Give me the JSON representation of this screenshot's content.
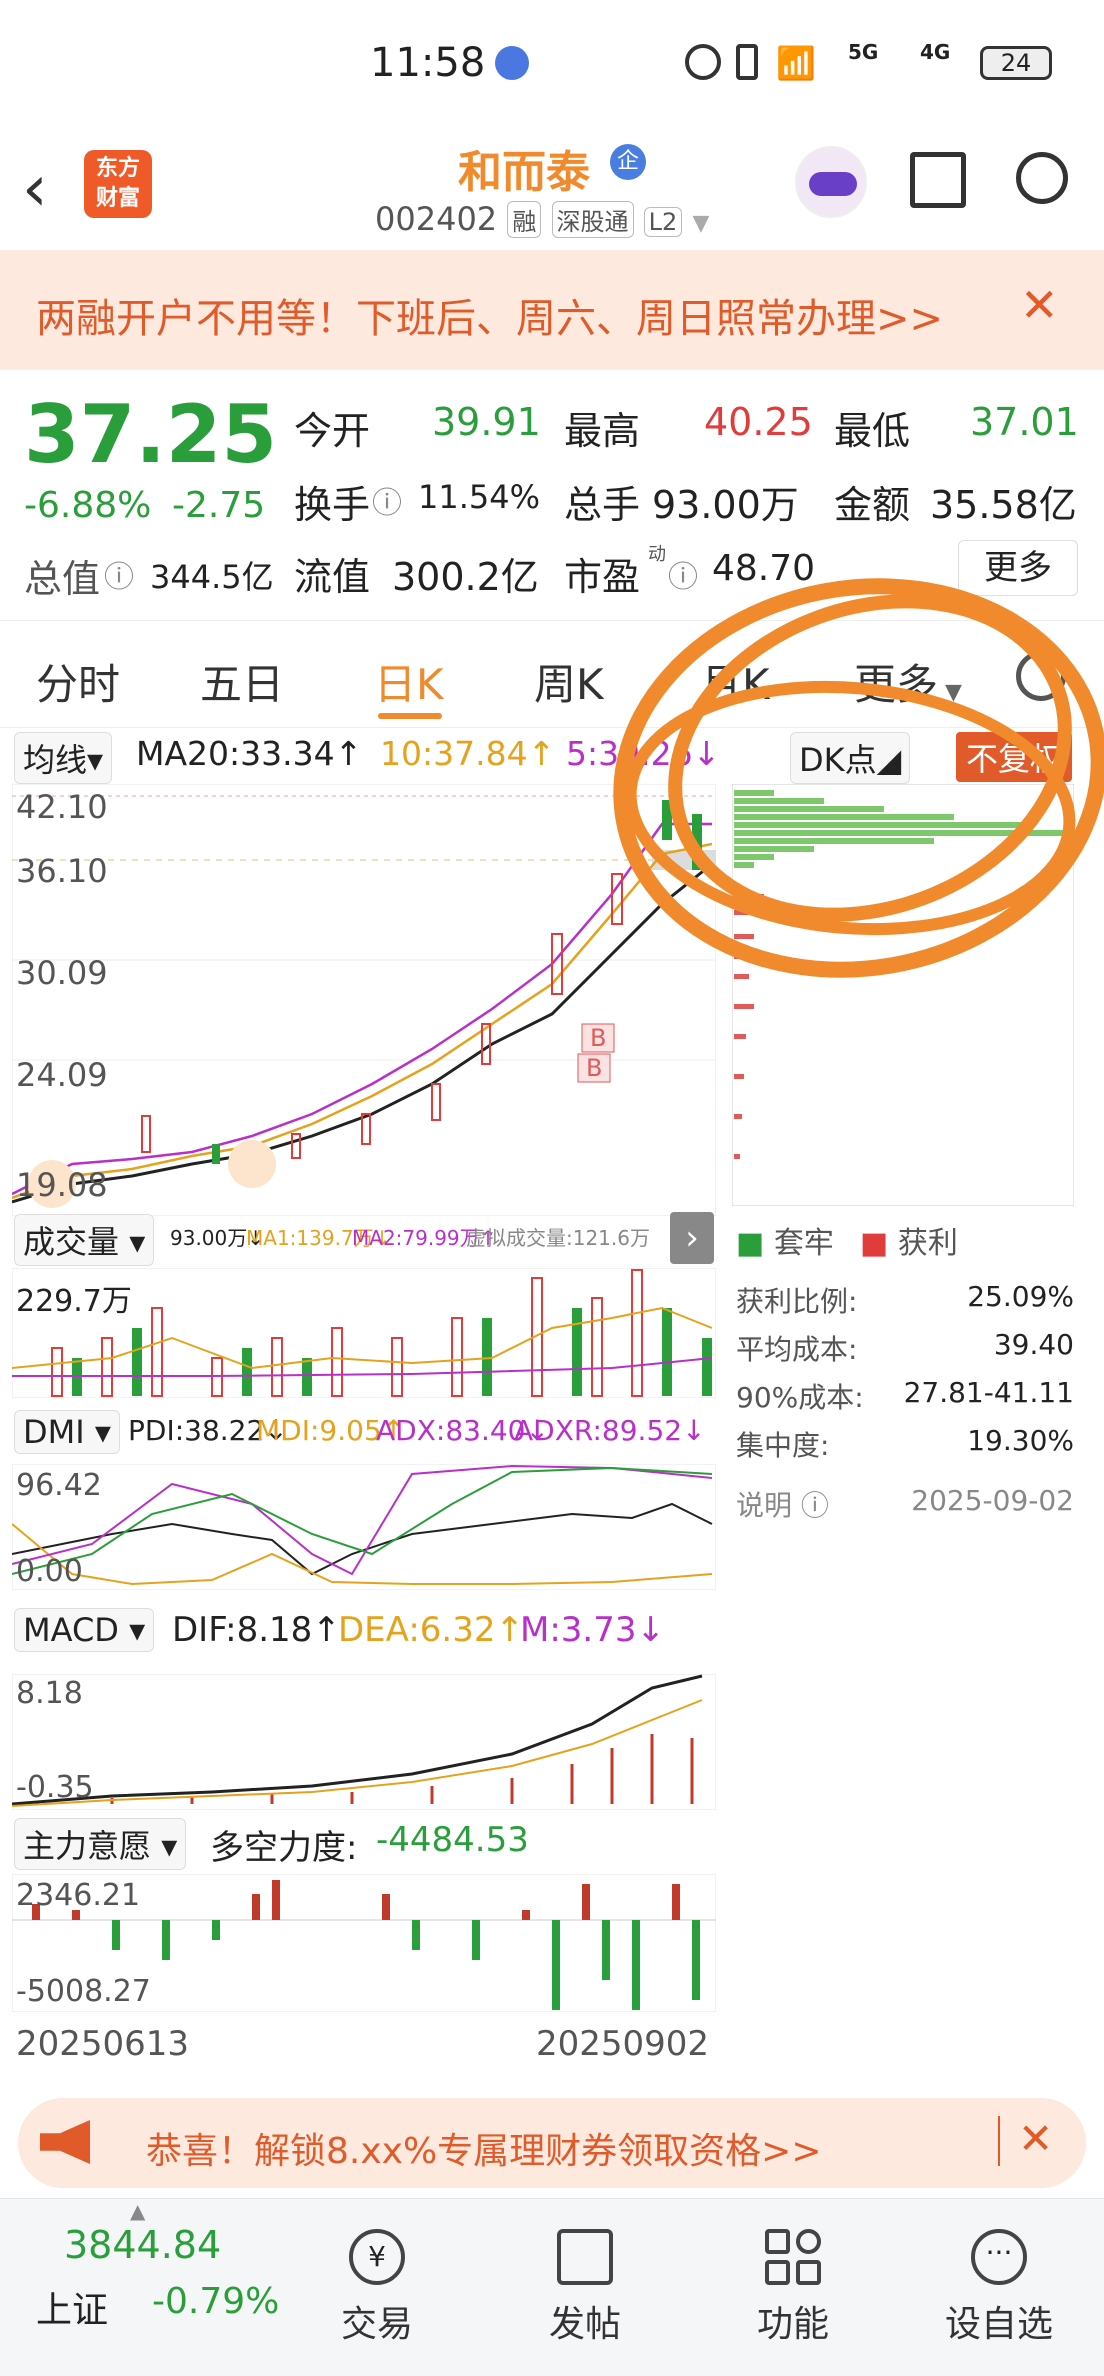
{
  "status_bar": {
    "time": "11:58",
    "network": "4G",
    "network2": "5G",
    "battery": "24"
  },
  "header": {
    "app_logo_line1": "东方",
    "app_logo_line2": "财富",
    "stock_name": "和而泰",
    "badge": "企",
    "stock_code": "002402",
    "tags": [
      "融",
      "深股通",
      "L2"
    ]
  },
  "banner": {
    "text": "两融开户不用等！下班后、周六、周日照常办理>>"
  },
  "quote": {
    "price": "37.25",
    "change_pct": "-6.88%",
    "change_amt": "-2.75",
    "open_label": "今开",
    "open": "39.91",
    "high_label": "最高",
    "high": "40.25",
    "low_label": "最低",
    "low": "37.01",
    "turnover_label": "换手",
    "turnover": "11.54%",
    "volume_label": "总手",
    "volume": "93.00万",
    "amount_label": "金额",
    "amount": "35.58亿",
    "mktcap_label": "总值",
    "mktcap": "344.5亿",
    "float_label": "流值",
    "float_cap": "300.2亿",
    "pe_label": "市盈",
    "pe_sup": "动",
    "pe": "48.70",
    "more_label": "更多"
  },
  "tabs": [
    "分时",
    "五日",
    "日K",
    "周K",
    "月K",
    "更多"
  ],
  "active_tab": "日K",
  "kline": {
    "indicator_label": "均线",
    "ma20": "MA20:33.34↑",
    "ma10": "10:37.84↑",
    "ma5": "5:39.26↓",
    "dk_label": "DK点",
    "fq_label": "不复权",
    "y_ticks": [
      "42.10",
      "36.10",
      "30.09",
      "24.09",
      "19.08"
    ],
    "marker_b": "B"
  },
  "volume": {
    "label": "成交量",
    "vol": "93.00万↓",
    "ma1": "MA1:139.7万↓",
    "ma2": "MA2:79.99万↑",
    "virtual": "虚拟成交量:121.6万",
    "y_top": "229.7万"
  },
  "dmi": {
    "label": "DMI",
    "pdi": "PDI:38.22↓",
    "mdi": "MDI:9.05↑",
    "adx": "ADX:83.40↓",
    "adxr": "ADXR:89.52↓",
    "y_top": "96.42",
    "y_bottom": "0.00"
  },
  "macd": {
    "label": "MACD",
    "dif": "DIF:8.18↑",
    "dea": "DEA:6.32↑",
    "m": "M:3.73↓",
    "y_top": "8.18",
    "y_bottom": "-0.35"
  },
  "main_force": {
    "label": "主力意愿",
    "power_label": "多空力度:",
    "power": "-4484.53",
    "y_top": "2346.21",
    "y_bottom": "-5008.27"
  },
  "dates": {
    "start": "20250613",
    "end": "20250902"
  },
  "chip": {
    "legend_trapped": "套牢",
    "legend_profit": "获利",
    "rows": [
      {
        "label": "获利比例:",
        "value": "25.09%"
      },
      {
        "label": "平均成本:",
        "value": "39.40"
      },
      {
        "label": "90%成本:",
        "value": "27.81-41.11"
      },
      {
        "label": "集中度:",
        "value": "19.30%"
      }
    ],
    "note_label": "说明",
    "date": "2025-09-02"
  },
  "ad": {
    "text": "恭喜！解锁8.xx%专属理财券领取资格>>"
  },
  "bottom_nav": {
    "index_value": "3844.84",
    "index_name": "上证",
    "index_change": "-0.79%",
    "items": [
      "交易",
      "发帖",
      "功能",
      "设自选"
    ]
  },
  "colors": {
    "up": "#e03c3c",
    "down": "#2a9e3a",
    "accent": "#f08a2c",
    "ma10": "#e5a21c",
    "ma5": "#b82fc9"
  },
  "chart_data": [
    {
      "type": "bar",
      "title": "",
      "series": [
        {
          "name": "获利",
          "values": [
            25.09
          ]
        }
      ],
      "ylabel": "",
      "xlabel": ""
    }
  ]
}
